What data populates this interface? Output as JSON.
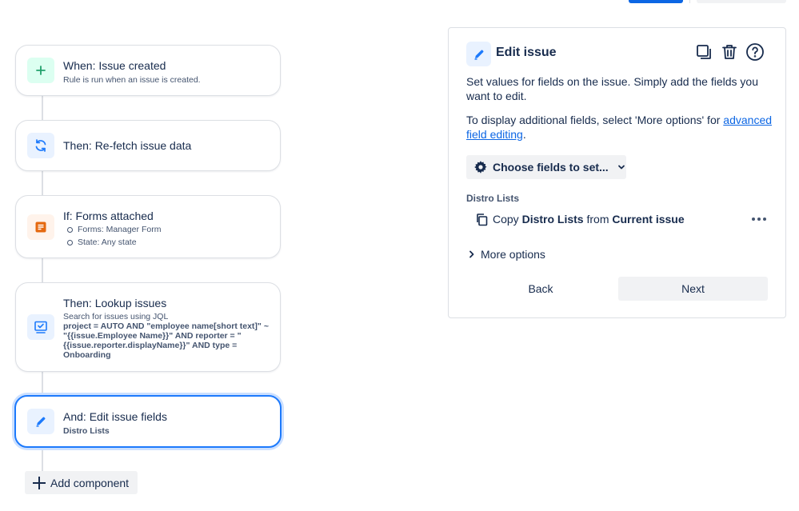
{
  "flow": {
    "trigger": {
      "title": "When: Issue created",
      "subtitle": "Rule is run when an issue is created.",
      "icon": "plus-icon",
      "color": "#22a06b"
    },
    "refetch": {
      "title": "Then: Re-fetch issue data",
      "icon": "refresh-icon",
      "color": "#1d7afc"
    },
    "condition": {
      "title": "If: Forms attached",
      "bullets": [
        "Forms: Manager Form",
        "State: Any state"
      ],
      "icon": "form-icon",
      "color": "#e56910"
    },
    "lookup": {
      "title": "Then: Lookup issues",
      "subtitle": "Search for issues using JQL",
      "jql": "project = AUTO AND \"employee name[short text]\" ~ \"{{issue.Employee Name}}\" AND reporter = \"{{issue.reporter.displayName}}\" AND type = Onboarding",
      "icon": "lookup-icon",
      "color": "#1d7afc"
    },
    "edit": {
      "title": "And: Edit issue fields",
      "subtitle": "Distro Lists",
      "icon": "pencil-icon",
      "color": "#1d7afc"
    },
    "add_component_label": "Add component"
  },
  "panel": {
    "title": "Edit issue",
    "description": "Set values for fields on the issue. Simply add the fields you want to edit.",
    "advanced_prefix": "To display additional fields, select 'More options' for ",
    "advanced_link": "advanced field editing",
    "advanced_suffix": ".",
    "choose_fields_label": "Choose fields to set...",
    "field_label": "Distro Lists",
    "field_row": {
      "copy": "Copy",
      "field": "Distro Lists",
      "from": "from",
      "source": "Current issue"
    },
    "more_options_label": "More options",
    "back_label": "Back",
    "next_label": "Next"
  },
  "colors": {
    "accent": "#0c66e4",
    "selected_border": "#1d7afc",
    "neutral_bg": "#f1f2f4",
    "border": "#dcdfe4"
  }
}
